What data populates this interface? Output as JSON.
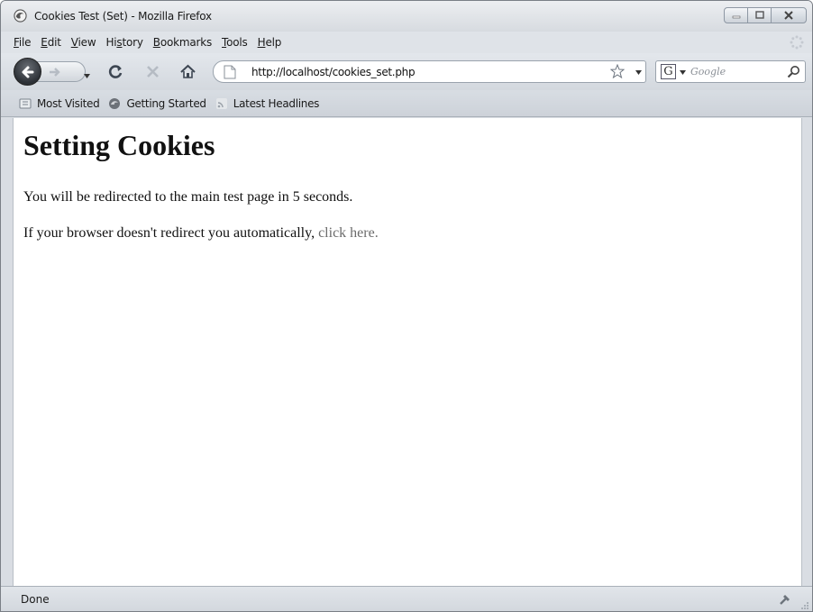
{
  "window": {
    "title": "Cookies Test (Set) - Mozilla Firefox"
  },
  "menu": {
    "items": [
      {
        "accel": "F",
        "rest": "ile"
      },
      {
        "accel": "E",
        "rest": "dit"
      },
      {
        "accel": "V",
        "rest": "iew"
      },
      {
        "pre": "Hi",
        "accel": "s",
        "rest": "tory"
      },
      {
        "accel": "B",
        "rest": "ookmarks"
      },
      {
        "accel": "T",
        "rest": "ools"
      },
      {
        "accel": "H",
        "rest": "elp"
      }
    ]
  },
  "navbar": {
    "url": "http://localhost/cookies_set.php",
    "search_placeholder": "Google",
    "search_engine_letter": "G"
  },
  "bookmarks": {
    "items": [
      {
        "label": "Most Visited",
        "icon": "bookmarks-folder-icon"
      },
      {
        "label": "Getting Started",
        "icon": "firefox-icon"
      },
      {
        "label": "Latest Headlines",
        "icon": "rss-feed-icon"
      }
    ]
  },
  "page": {
    "heading": "Setting Cookies",
    "redirect_text": "You will be redirected to the main test page in 5 seconds.",
    "fallback_text": "If your browser doesn't redirect you automatically, ",
    "fallback_link": "click here."
  },
  "status": {
    "text": "Done"
  },
  "colors": {
    "link": "#6b6b6b",
    "chrome": "#d9dde3"
  }
}
